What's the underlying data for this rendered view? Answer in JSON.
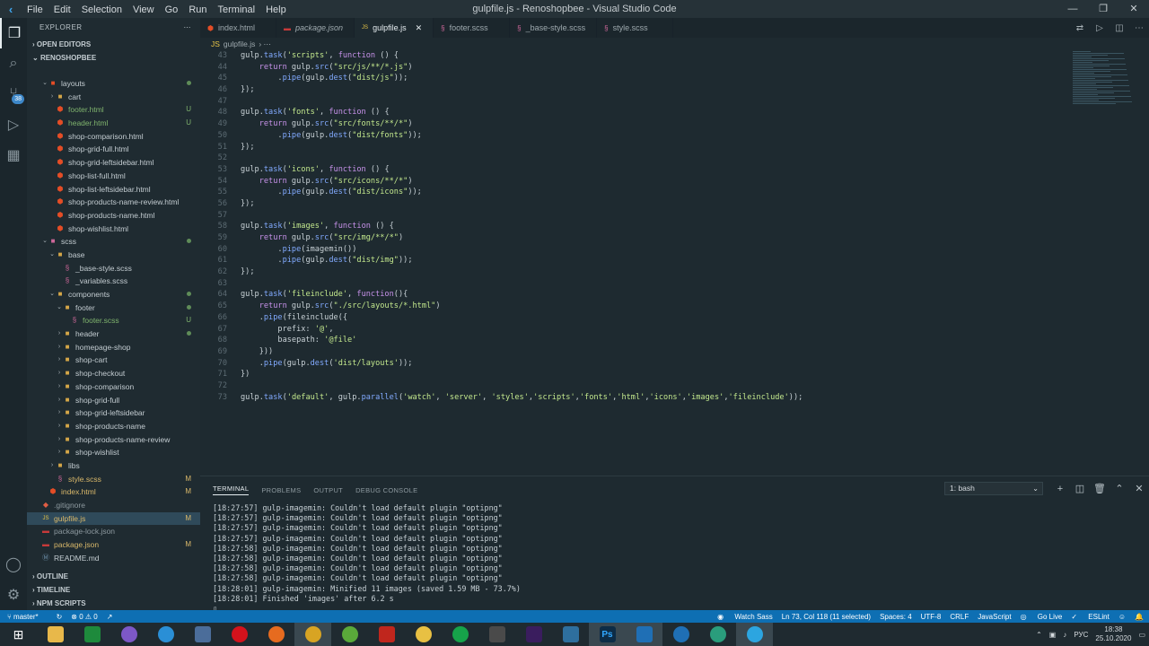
{
  "titlebar": {
    "menu": [
      "File",
      "Edit",
      "Selection",
      "View",
      "Go",
      "Run",
      "Terminal",
      "Help"
    ],
    "title": "gulpfile.js - Renoshopbee - Visual Studio Code"
  },
  "sidebar": {
    "header": "EXPLORER",
    "open_editors": "OPEN EDITORS",
    "project": "RENOSHOPBEE",
    "tree": [
      {
        "label": "layouts",
        "depth": 1,
        "type": "folder",
        "open": true,
        "status": "dot",
        "color": "#e44d26"
      },
      {
        "label": "cart",
        "depth": 2,
        "type": "folder",
        "open": false,
        "status": "",
        "color": "#d4a648"
      },
      {
        "label": "footer.html",
        "depth": 2,
        "type": "html",
        "status": "U"
      },
      {
        "label": "header.html",
        "depth": 2,
        "type": "html",
        "status": "U"
      },
      {
        "label": "shop-comparison.html",
        "depth": 2,
        "type": "html",
        "status": ""
      },
      {
        "label": "shop-grid-full.html",
        "depth": 2,
        "type": "html",
        "status": ""
      },
      {
        "label": "shop-grid-leftsidebar.html",
        "depth": 2,
        "type": "html",
        "status": ""
      },
      {
        "label": "shop-list-full.html",
        "depth": 2,
        "type": "html",
        "status": ""
      },
      {
        "label": "shop-list-leftsidebar.html",
        "depth": 2,
        "type": "html",
        "status": ""
      },
      {
        "label": "shop-products-name-review.html",
        "depth": 2,
        "type": "html",
        "status": ""
      },
      {
        "label": "shop-products-name.html",
        "depth": 2,
        "type": "html",
        "status": ""
      },
      {
        "label": "shop-wishlist.html",
        "depth": 2,
        "type": "html",
        "status": ""
      },
      {
        "label": "scss",
        "depth": 1,
        "type": "folder",
        "open": true,
        "status": "dot",
        "color": "#cd6799"
      },
      {
        "label": "base",
        "depth": 2,
        "type": "folder",
        "open": true,
        "status": "",
        "color": "#d4a648"
      },
      {
        "label": "_base-style.scss",
        "depth": 3,
        "type": "scss",
        "status": ""
      },
      {
        "label": "_variables.scss",
        "depth": 3,
        "type": "scss",
        "status": ""
      },
      {
        "label": "components",
        "depth": 2,
        "type": "folder",
        "open": true,
        "status": "dot",
        "color": "#d4a648"
      },
      {
        "label": "footer",
        "depth": 3,
        "type": "folder",
        "open": true,
        "status": "dot",
        "color": "#d4a648"
      },
      {
        "label": "footer.scss",
        "depth": 4,
        "type": "scss",
        "status": "U"
      },
      {
        "label": "header",
        "depth": 3,
        "type": "folder",
        "open": false,
        "status": "dot",
        "color": "#d4a648"
      },
      {
        "label": "homepage-shop",
        "depth": 3,
        "type": "folder",
        "open": false,
        "status": "",
        "color": "#d4a648"
      },
      {
        "label": "shop-cart",
        "depth": 3,
        "type": "folder",
        "open": false,
        "status": "",
        "color": "#d4a648"
      },
      {
        "label": "shop-checkout",
        "depth": 3,
        "type": "folder",
        "open": false,
        "status": "",
        "color": "#d4a648"
      },
      {
        "label": "shop-comparison",
        "depth": 3,
        "type": "folder",
        "open": false,
        "status": "",
        "color": "#d4a648"
      },
      {
        "label": "shop-grid-full",
        "depth": 3,
        "type": "folder",
        "open": false,
        "status": "",
        "color": "#d4a648"
      },
      {
        "label": "shop-grid-leftsidebar",
        "depth": 3,
        "type": "folder",
        "open": false,
        "status": "",
        "color": "#d4a648"
      },
      {
        "label": "shop-products-name",
        "depth": 3,
        "type": "folder",
        "open": false,
        "status": "",
        "color": "#d4a648"
      },
      {
        "label": "shop-products-name-review",
        "depth": 3,
        "type": "folder",
        "open": false,
        "status": "",
        "color": "#d4a648"
      },
      {
        "label": "shop-wishlist",
        "depth": 3,
        "type": "folder",
        "open": false,
        "status": "",
        "color": "#d4a648"
      },
      {
        "label": "libs",
        "depth": 2,
        "type": "folder",
        "open": false,
        "status": "",
        "color": "#d4a648"
      },
      {
        "label": "style.scss",
        "depth": 2,
        "type": "scss",
        "status": "M"
      },
      {
        "label": "index.html",
        "depth": 1,
        "type": "html",
        "status": "M"
      },
      {
        "label": ".gitignore",
        "depth": 0,
        "type": "git",
        "status": ""
      },
      {
        "label": "gulpfile.js",
        "depth": 0,
        "type": "js",
        "status": "M",
        "selected": true
      },
      {
        "label": "package-lock.json",
        "depth": 0,
        "type": "npm",
        "status": ""
      },
      {
        "label": "package.json",
        "depth": 0,
        "type": "npm",
        "status": "M"
      },
      {
        "label": "README.md",
        "depth": 0,
        "type": "md",
        "status": ""
      }
    ],
    "outline": "OUTLINE",
    "timeline": "TIMELINE",
    "npm_scripts": "NPM SCRIPTS"
  },
  "tabs": [
    {
      "label": "index.html",
      "icon": "html",
      "active": false
    },
    {
      "label": "package.json",
      "icon": "npm",
      "active": false,
      "italic": true
    },
    {
      "label": "gulpfile.js",
      "icon": "js",
      "active": true
    },
    {
      "label": "footer.scss",
      "icon": "scss",
      "active": false
    },
    {
      "label": "_base-style.scss",
      "icon": "scss",
      "active": false
    },
    {
      "label": "style.scss",
      "icon": "scss",
      "active": false
    }
  ],
  "breadcrumb": "gulpfile.js",
  "code_lines": [
    {
      "n": "43",
      "t": "gulp.task('scripts', function () {"
    },
    {
      "n": "44",
      "t": "    return gulp.src(\"src/js/**/*.js\")"
    },
    {
      "n": "45",
      "t": "        .pipe(gulp.dest(\"dist/js\"));"
    },
    {
      "n": "46",
      "t": "});"
    },
    {
      "n": "47",
      "t": ""
    },
    {
      "n": "48",
      "t": "gulp.task('fonts', function () {"
    },
    {
      "n": "49",
      "t": "    return gulp.src(\"src/fonts/**/*\")"
    },
    {
      "n": "50",
      "t": "        .pipe(gulp.dest(\"dist/fonts\"));"
    },
    {
      "n": "51",
      "t": "});"
    },
    {
      "n": "52",
      "t": ""
    },
    {
      "n": "53",
      "t": "gulp.task('icons', function () {"
    },
    {
      "n": "54",
      "t": "    return gulp.src(\"src/icons/**/*\")"
    },
    {
      "n": "55",
      "t": "        .pipe(gulp.dest(\"dist/icons\"));"
    },
    {
      "n": "56",
      "t": "});"
    },
    {
      "n": "57",
      "t": ""
    },
    {
      "n": "58",
      "t": "gulp.task('images', function () {"
    },
    {
      "n": "59",
      "t": "    return gulp.src(\"src/img/**/*\")"
    },
    {
      "n": "60",
      "t": "        .pipe(imagemin())"
    },
    {
      "n": "61",
      "t": "        .pipe(gulp.dest(\"dist/img\"));"
    },
    {
      "n": "62",
      "t": "});"
    },
    {
      "n": "63",
      "t": ""
    },
    {
      "n": "64",
      "t": "gulp.task('fileinclude', function(){"
    },
    {
      "n": "65",
      "t": "    return gulp.src(\"./src/layouts/*.html\")"
    },
    {
      "n": "66",
      "t": "    .pipe(fileinclude({"
    },
    {
      "n": "67",
      "t": "        prefix: '@',"
    },
    {
      "n": "68",
      "t": "        basepath: '@file'"
    },
    {
      "n": "69",
      "t": "    }))"
    },
    {
      "n": "70",
      "t": "    .pipe(gulp.dest('dist/layouts'));"
    },
    {
      "n": "71",
      "t": "})"
    },
    {
      "n": "72",
      "t": ""
    },
    {
      "n": "73",
      "t": "gulp.task('default', gulp.parallel('watch', 'server', 'styles','scripts','fonts','html','icons','images','fileinclude'));"
    }
  ],
  "panel": {
    "tabs": [
      "TERMINAL",
      "PROBLEMS",
      "OUTPUT",
      "DEBUG CONSOLE"
    ],
    "shell": "1: bash",
    "lines": [
      "[18:27:57] gulp-imagemin: Couldn't load default plugin \"optipng\"",
      "[18:27:57] gulp-imagemin: Couldn't load default plugin \"optipng\"",
      "[18:27:57] gulp-imagemin: Couldn't load default plugin \"optipng\"",
      "[18:27:57] gulp-imagemin: Couldn't load default plugin \"optipng\"",
      "[18:27:58] gulp-imagemin: Couldn't load default plugin \"optipng\"",
      "[18:27:58] gulp-imagemin: Couldn't load default plugin \"optipng\"",
      "[18:27:58] gulp-imagemin: Couldn't load default plugin \"optipng\"",
      "[18:27:58] gulp-imagemin: Couldn't load default plugin \"optipng\"",
      "[18:28:01] gulp-imagemin: Minified 11 images (saved 1.59 MB - 73.7%)",
      "[18:28:01] Finished 'images' after 6.2 s"
    ]
  },
  "statusbar": {
    "branch": "master*",
    "problems": "⊗ 0 ⚠ 0",
    "watch_sass": "Watch Sass",
    "position": "Ln 73, Col 118 (11 selected)",
    "spaces": "Spaces: 4",
    "encoding": "UTF-8",
    "eol": "CRLF",
    "language": "JavaScript",
    "golive": "Go Live",
    "eslint": "ESLint"
  },
  "taskbar": {
    "lang": "РУС",
    "time": "18:38",
    "date": "25.10.2020"
  },
  "colors": {
    "accent": "#0e6fb3",
    "editor_bg": "#1e2a30"
  }
}
